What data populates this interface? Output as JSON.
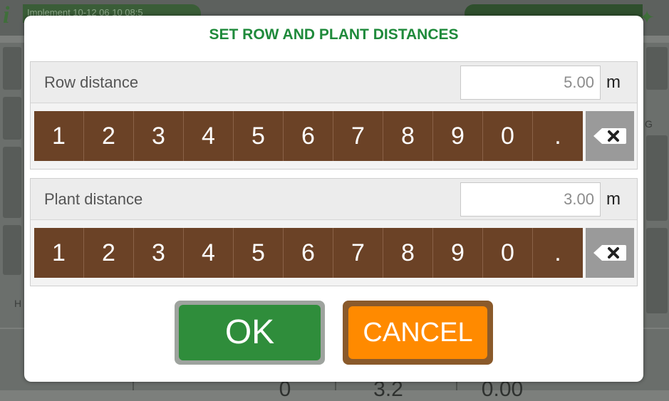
{
  "background": {
    "implement_text": "Implement 10-12 06 10 08:5",
    "side_letters": [
      "G",
      "H"
    ],
    "bottom_values": [
      "0",
      "3.2",
      "0.00"
    ]
  },
  "dialog": {
    "title": "SET ROW AND PLANT DISTANCES",
    "row": {
      "label": "Row distance",
      "value": "5.00",
      "unit": "m"
    },
    "plant": {
      "label": "Plant distance",
      "value": "3.00",
      "unit": "m"
    },
    "keys": [
      "1",
      "2",
      "3",
      "4",
      "5",
      "6",
      "7",
      "8",
      "9",
      "0",
      "."
    ],
    "ok_label": "OK",
    "cancel_label": "CANCEL"
  },
  "colors": {
    "title_green": "#1f8a3b",
    "key_brown": "#6b4226",
    "ok_green": "#2f8d3b",
    "cancel_orange": "#ff8a00"
  }
}
